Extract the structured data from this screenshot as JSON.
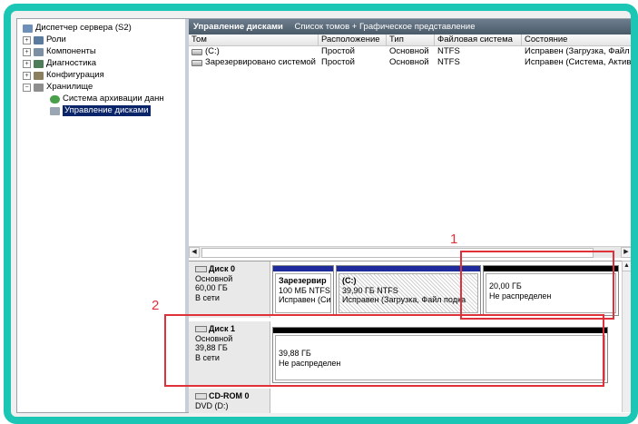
{
  "tree": {
    "root": "Диспетчер сервера (S2)",
    "items": [
      "Роли",
      "Компоненты",
      "Диагностика",
      "Конфигурация",
      "Хранилище"
    ],
    "storage_children": [
      "Система архивации данн",
      "Управление дисками"
    ]
  },
  "title": {
    "main": "Управление дисками",
    "sub": "Список томов + Графическое представление"
  },
  "columns": [
    "Том",
    "Расположение",
    "Тип",
    "Файловая система",
    "Состояние"
  ],
  "volumes": [
    {
      "name": "(C:)",
      "location": "Простой",
      "type": "Основной",
      "fs": "NTFS",
      "status": "Исправен (Загрузка, Файл"
    },
    {
      "name": "Зарезервировано системой",
      "location": "Простой",
      "type": "Основной",
      "fs": "NTFS",
      "status": "Исправен (Система, Актив"
    }
  ],
  "disks": [
    {
      "name": "Диск 0",
      "type": "Основной",
      "size": "60,00 ГБ",
      "state": "В сети",
      "partitions": [
        {
          "title": "Зарезервир",
          "line2": "100 МБ NTFS",
          "line3": "Исправен (Си"
        },
        {
          "title": "(C:)",
          "line2": "39,90 ГБ NTFS",
          "line3": "Исправен (Загрузка, Файл подка"
        },
        {
          "title": "",
          "line2": "20,00 ГБ",
          "line3": "Не распределен"
        }
      ]
    },
    {
      "name": "Диск 1",
      "type": "Основной",
      "size": "39,88 ГБ",
      "state": "В сети",
      "partitions": [
        {
          "title": "",
          "line2": "39,88 ГБ",
          "line3": "Не распределен"
        }
      ]
    },
    {
      "name": "CD-ROM 0",
      "type": "DVD (D:)"
    }
  ],
  "annotations": {
    "label1": "1",
    "label2": "2"
  },
  "colors": {
    "frame": "#1cc6b4",
    "primary_partition": "#1f2b9a",
    "unallocated": "#000000",
    "annotation": "#e0303a"
  }
}
